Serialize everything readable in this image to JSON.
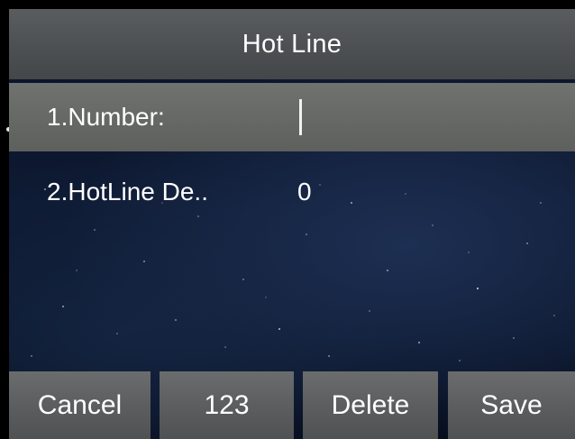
{
  "header": {
    "title": "Hot Line"
  },
  "fields": [
    {
      "label": "1.Number:",
      "value": "",
      "selected": true
    },
    {
      "label": "2.HotLine De..",
      "value": "0",
      "selected": false
    }
  ],
  "softkeys": [
    {
      "label": "Cancel"
    },
    {
      "label": "123"
    },
    {
      "label": "Delete"
    },
    {
      "label": "Save"
    }
  ],
  "colors": {
    "title_bar": "#505355",
    "selected_row": "#686a68",
    "softkey": "#5d5f61",
    "background": "#0c1730",
    "text": "#ffffff"
  }
}
